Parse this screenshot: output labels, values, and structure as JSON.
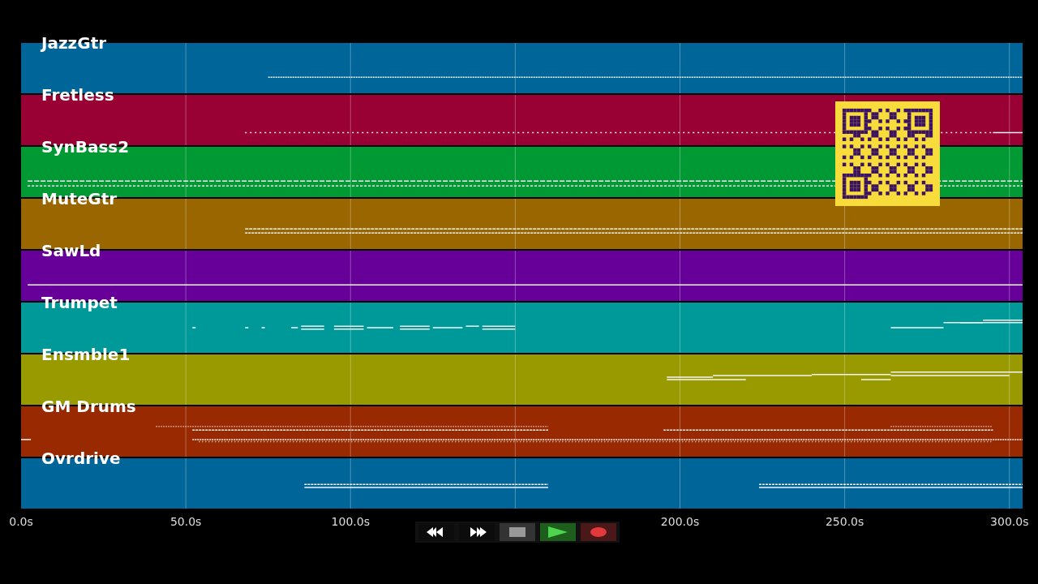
{
  "tracks": [
    {
      "name": "JazzGtr",
      "color": "#006699"
    },
    {
      "name": "Fretless",
      "color": "#990033"
    },
    {
      "name": "SynBass2",
      "color": "#009933"
    },
    {
      "name": "MuteGtr",
      "color": "#996600"
    },
    {
      "name": "SawLd",
      "color": "#660099"
    },
    {
      "name": "Trumpet",
      "color": "#009999"
    },
    {
      "name": "Ensmble1",
      "color": "#999900"
    },
    {
      "name": "GM Drums",
      "color": "#992900"
    },
    {
      "name": "Ovrdrive",
      "color": "#006699"
    }
  ],
  "time_axis": {
    "labels": [
      "0.0s",
      "50.0s",
      "100.0s",
      "200.0s",
      "250.0s",
      "300.0s"
    ]
  },
  "transport": {
    "buttons": [
      {
        "kind": "rewind"
      },
      {
        "kind": "fast-forward"
      },
      {
        "kind": "stop"
      },
      {
        "kind": "play"
      },
      {
        "kind": "record"
      }
    ]
  }
}
